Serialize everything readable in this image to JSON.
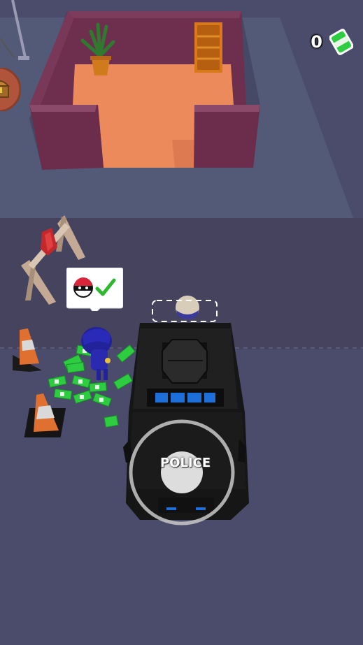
{
  "hud": {
    "money_count": "0",
    "money_icon": "cash-stack-icon",
    "chest_icon": "treasure-chest-icon"
  },
  "vehicle": {
    "label": "POLICE"
  },
  "bubble": {
    "icon": "thief-mask-icon",
    "status_icon": "checkmark-icon"
  },
  "colors": {
    "floor": "#4a4a6a",
    "room_floor": "#ed8a5c",
    "room_wall": "#6e2f4f",
    "money_green": "#2ecc40",
    "check_green": "#2eb82e",
    "police_blue": "#1e6fd9"
  }
}
